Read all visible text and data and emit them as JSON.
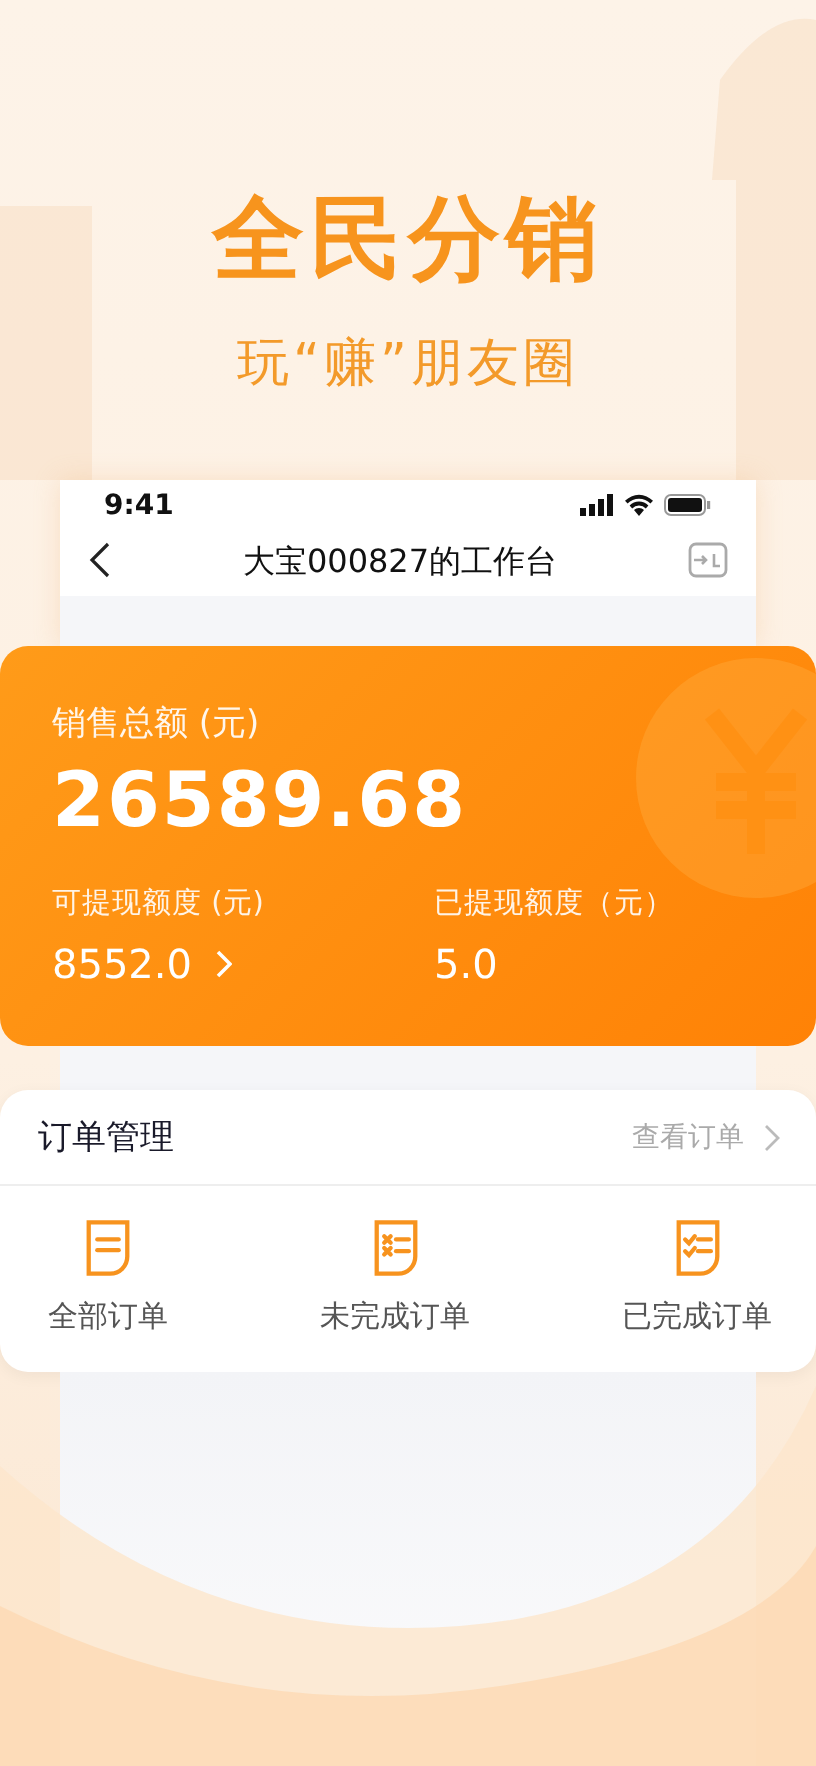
{
  "promo": {
    "headline": "全民分销",
    "subtitle": "玩“赚”朋友圈"
  },
  "status_bar": {
    "time": "9:41"
  },
  "nav_bar": {
    "title": "大宝000827的工作台"
  },
  "sales_card": {
    "total_label": "销售总额 (元)",
    "total_value": "26589.68",
    "stats": [
      {
        "label": "可提现额度 (元)",
        "value": "8552.0",
        "kind": "link"
      },
      {
        "label": "已提现额度（元）",
        "value": "5.0",
        "kind": "plain"
      }
    ]
  },
  "orders": {
    "title": "订单管理",
    "link": "查看订单",
    "items": [
      {
        "label": "全部订单",
        "kind": "all"
      },
      {
        "label": "未完成订单",
        "kind": "pending"
      },
      {
        "label": "已完成订单",
        "kind": "done"
      }
    ]
  }
}
